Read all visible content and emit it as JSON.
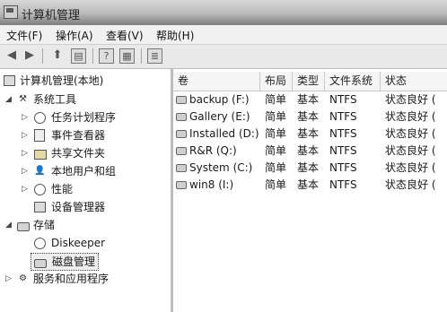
{
  "window": {
    "title": "计算机管理"
  },
  "menu": {
    "items": [
      "文件(F)",
      "操作(A)",
      "查看(V)",
      "帮助(H)"
    ]
  },
  "tree": {
    "root": "计算机管理(本地)",
    "system_tools": "系统工具",
    "task_scheduler": "任务计划程序",
    "event_viewer": "事件查看器",
    "shared_folders": "共享文件夹",
    "local_users": "本地用户和组",
    "performance": "性能",
    "device_manager": "设备管理器",
    "storage": "存储",
    "diskeeper": "Diskeeper",
    "disk_management": "磁盘管理",
    "services": "服务和应用程序"
  },
  "table": {
    "columns": [
      "卷",
      "布局",
      "类型",
      "文件系统",
      "状态"
    ],
    "rows": [
      {
        "volume": "backup (F:)",
        "layout": "简单",
        "type": "基本",
        "fs": "NTFS",
        "status": "状态良好 ("
      },
      {
        "volume": "Gallery (E:)",
        "layout": "简单",
        "type": "基本",
        "fs": "NTFS",
        "status": "状态良好 ("
      },
      {
        "volume": "Installed (D:)",
        "layout": "简单",
        "type": "基本",
        "fs": "NTFS",
        "status": "状态良好 ("
      },
      {
        "volume": "R&R (Q:)",
        "layout": "简单",
        "type": "基本",
        "fs": "NTFS",
        "status": "状态良好 ("
      },
      {
        "volume": "System (C:)",
        "layout": "简单",
        "type": "基本",
        "fs": "NTFS",
        "status": "状态良好 ("
      },
      {
        "volume": "win8 (I:)",
        "layout": "简单",
        "type": "基本",
        "fs": "NTFS",
        "status": "状态良好 ("
      }
    ]
  }
}
